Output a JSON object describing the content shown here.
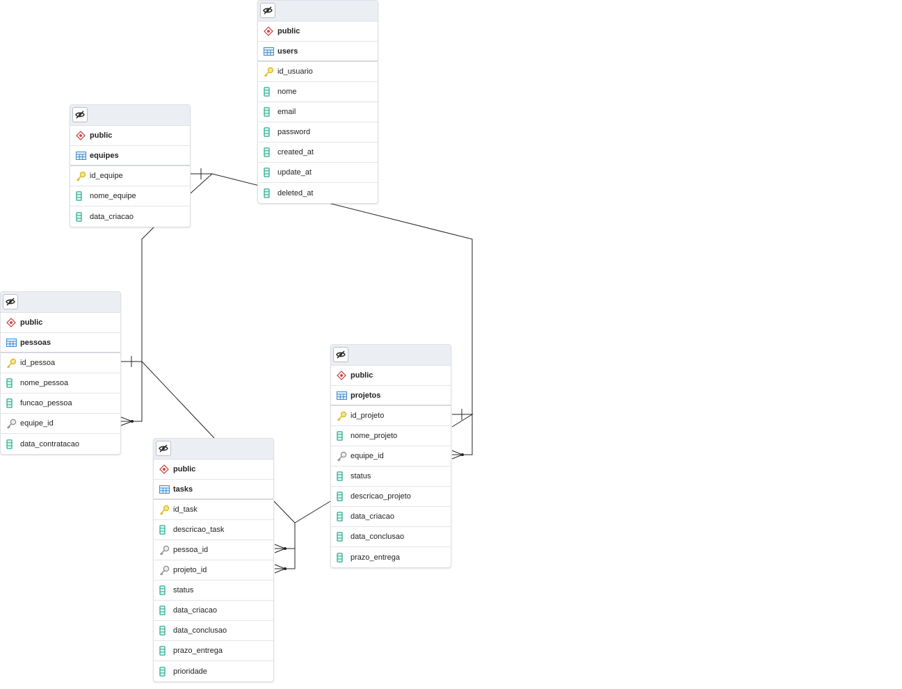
{
  "tables": [
    {
      "id": "users",
      "schema": "public",
      "name": "users",
      "columns": [
        {
          "name": "id_usuario",
          "kind": "pk"
        },
        {
          "name": "nome",
          "kind": "col"
        },
        {
          "name": "email",
          "kind": "col"
        },
        {
          "name": "password",
          "kind": "col"
        },
        {
          "name": "created_at",
          "kind": "col"
        },
        {
          "name": "update_at",
          "kind": "col"
        },
        {
          "name": "deleted_at",
          "kind": "col"
        }
      ]
    },
    {
      "id": "equipes",
      "schema": "public",
      "name": "equipes",
      "columns": [
        {
          "name": "id_equipe",
          "kind": "pk"
        },
        {
          "name": "nome_equipe",
          "kind": "col"
        },
        {
          "name": "data_criacao",
          "kind": "col"
        }
      ]
    },
    {
      "id": "pessoas",
      "schema": "public",
      "name": "pessoas",
      "columns": [
        {
          "name": "id_pessoa",
          "kind": "pk"
        },
        {
          "name": "nome_pessoa",
          "kind": "col"
        },
        {
          "name": "funcao_pessoa",
          "kind": "col"
        },
        {
          "name": "equipe_id",
          "kind": "fk"
        },
        {
          "name": "data_contratacao",
          "kind": "col"
        }
      ]
    },
    {
      "id": "projetos",
      "schema": "public",
      "name": "projetos",
      "columns": [
        {
          "name": "id_projeto",
          "kind": "pk"
        },
        {
          "name": "nome_projeto",
          "kind": "col"
        },
        {
          "name": "equipe_id",
          "kind": "fk"
        },
        {
          "name": "status",
          "kind": "col"
        },
        {
          "name": "descricao_projeto",
          "kind": "col"
        },
        {
          "name": "data_criacao",
          "kind": "col"
        },
        {
          "name": "data_conclusao",
          "kind": "col"
        },
        {
          "name": "prazo_entrega",
          "kind": "col"
        }
      ]
    },
    {
      "id": "tasks",
      "schema": "public",
      "name": "tasks",
      "columns": [
        {
          "name": "id_task",
          "kind": "pk"
        },
        {
          "name": "descricao_task",
          "kind": "col"
        },
        {
          "name": "pessoa_id",
          "kind": "fk"
        },
        {
          "name": "projeto_id",
          "kind": "fk"
        },
        {
          "name": "status",
          "kind": "col"
        },
        {
          "name": "data_criacao",
          "kind": "col"
        },
        {
          "name": "data_conclusao",
          "kind": "col"
        },
        {
          "name": "prazo_entrega",
          "kind": "col"
        },
        {
          "name": "prioridade",
          "kind": "col"
        }
      ]
    }
  ],
  "relationships": [
    {
      "from": "pessoas.equipe_id",
      "to": "equipes.id_equipe",
      "cardinality": "many-to-one"
    },
    {
      "from": "projetos.equipe_id",
      "to": "equipes.id_equipe",
      "cardinality": "many-to-one"
    },
    {
      "from": "tasks.pessoa_id",
      "to": "pessoas.id_pessoa",
      "cardinality": "many-to-one"
    },
    {
      "from": "tasks.projeto_id",
      "to": "projetos.id_projeto",
      "cardinality": "many-to-one"
    }
  ],
  "icons": {
    "visibility_toggle": "eye-off-icon",
    "schema": "schema-icon",
    "table": "table-icon",
    "primary_key": "primary-key-icon",
    "foreign_key": "foreign-key-icon",
    "column": "column-icon"
  },
  "colors": {
    "schema_icon": "#c94b4b",
    "table_icon": "#3a8ad1",
    "primary_key_icon": "#d9b51a",
    "foreign_key_icon": "#8a8a8a",
    "column_icon": "#1fa98c",
    "link": "#222222",
    "header_bg": "#ebeef3"
  }
}
